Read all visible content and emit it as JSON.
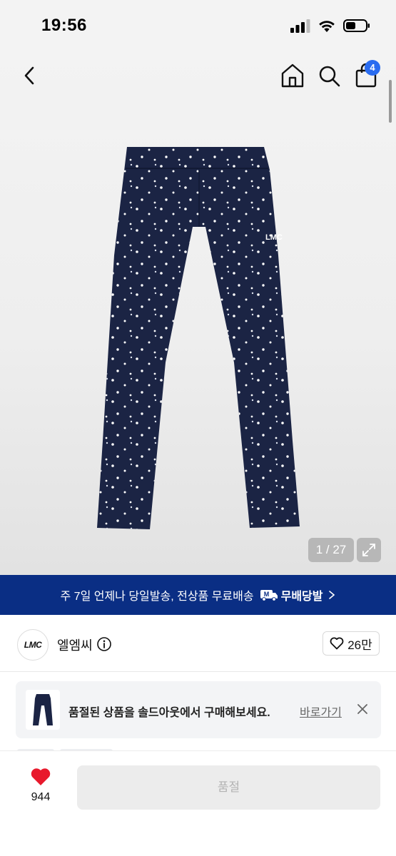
{
  "status_bar": {
    "time": "19:56"
  },
  "header": {
    "cart_count": "4"
  },
  "product": {
    "image_counter": "1 / 27",
    "garment_logo": "LMC"
  },
  "banner": {
    "text": "주 7일 언제나 당일발송, 전상품 무료배송",
    "badge_label": "무배당발",
    "badge_mark": "M"
  },
  "brand": {
    "logo_text": "LMC",
    "name": "엘엠씨",
    "likes": "26만"
  },
  "notice": {
    "text": "품절된 상품을 솔드아웃에서 구매해보세요.",
    "link_label": "바로가기"
  },
  "bottom": {
    "favorite_count": "944",
    "buy_button_label": "품절"
  },
  "colors": {
    "banner_bg": "#0a2e84",
    "badge_blue": "#2a6cf0",
    "heart_red": "#e8192c",
    "pants_navy": "#1b2444"
  }
}
